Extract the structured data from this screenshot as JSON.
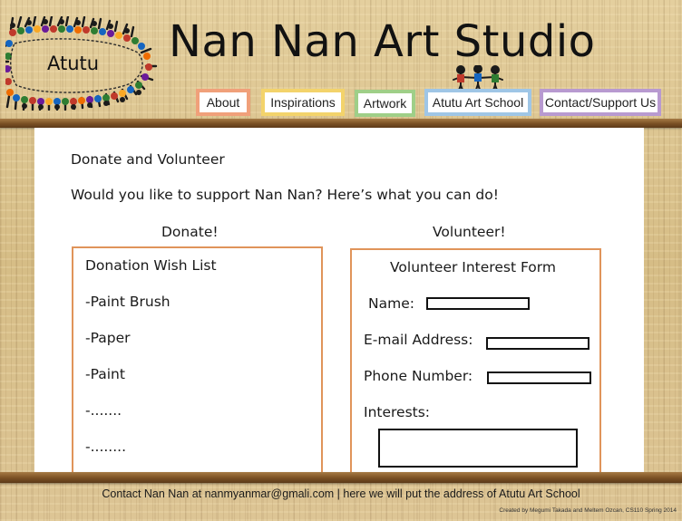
{
  "header": {
    "logo_text": "Atutu",
    "site_title": "Nan Nan Art Studio",
    "nav": [
      {
        "label": "About",
        "color": "#f0a07a"
      },
      {
        "label": "Inspirations",
        "color": "#f3d36b"
      },
      {
        "label": "Artwork",
        "color": "#9fcf88"
      },
      {
        "label": "Atutu Art School",
        "color": "#9fc6e6"
      },
      {
        "label": "Contact/Support Us",
        "color": "#b89ad0"
      }
    ]
  },
  "main": {
    "heading": "Donate and Volunteer",
    "intro": "Would you like to support Nan Nan? Here’s what you can do!",
    "donate": {
      "title": "Donate!",
      "box_title": "Donation Wish List",
      "items": [
        "-Paint Brush",
        "-Paper",
        "-Paint",
        "-.......",
        "-........"
      ]
    },
    "volunteer": {
      "title": "Volunteer!",
      "form_title": "Volunteer Interest Form",
      "name_label": "Name:",
      "email_label": "E-mail Address:",
      "phone_label": "Phone Number:",
      "interests_label": "Interests:"
    }
  },
  "footer": {
    "contact": "Contact Nan Nan at nanmyanmar@gmali.com  |  here we will put the address of Atutu Art School",
    "credit": "Created by Megumi Takada and Meltem Ozcan, CS110 Spring 2014"
  },
  "colors": {
    "box_border": "#e0945a",
    "plank": "#7a5024"
  }
}
